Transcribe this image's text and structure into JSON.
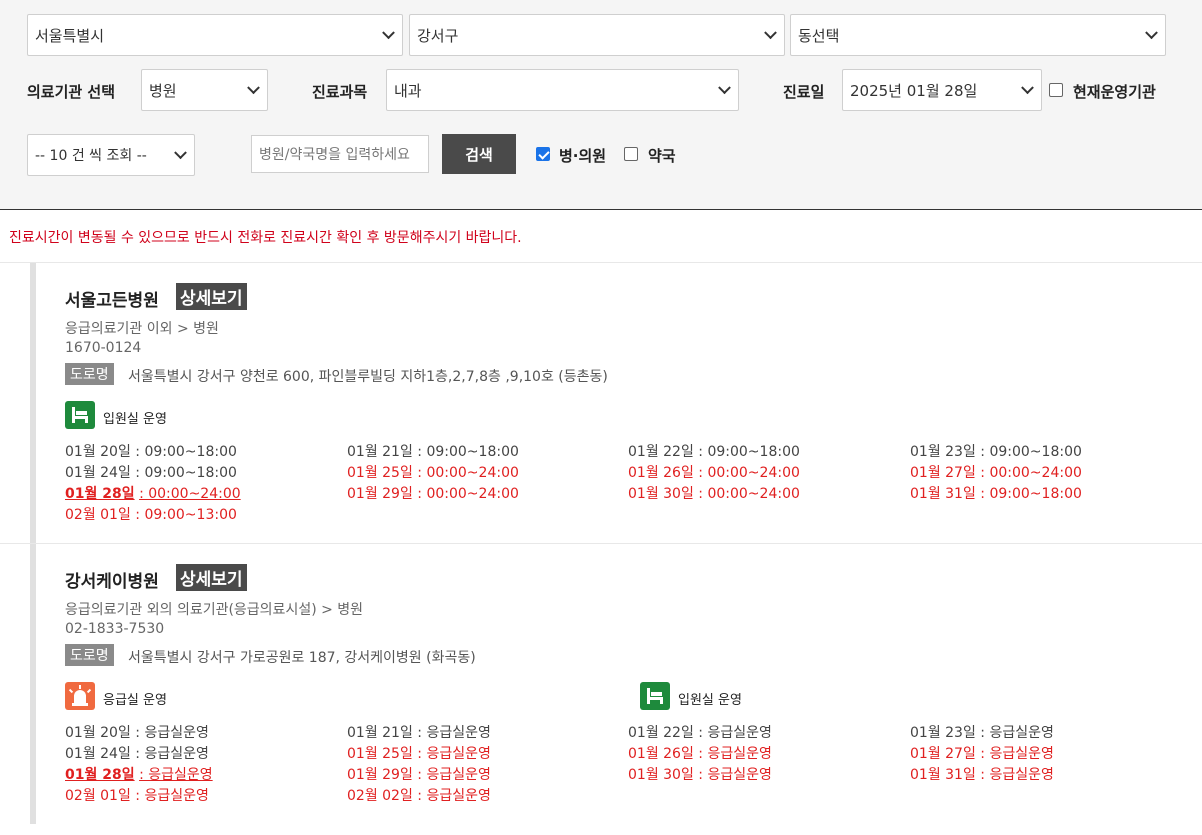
{
  "filters": {
    "region1": "서울특별시",
    "region2": "강서구",
    "region3": "동선택",
    "institution_label": "의료기관 선택",
    "institution_value": "병원",
    "department_label": "진료과목",
    "department_value": "내과",
    "date_label": "진료일",
    "date_value": "2025년 01월 28일",
    "open_now_label": "현재운영기관",
    "page_size": "-- 10 건 씩 조회 --",
    "search_placeholder": "병원/약국명을 입력하세요",
    "search_button": "검색",
    "hospital_label": "병·의원",
    "pharmacy_label": "약국"
  },
  "notice": "진료시간이 변동될 수 있으므로 반드시 전화로 진료시간 확인 후 방문해주시기 바랍니다.",
  "detail_label": "상세보기",
  "road_label": "도로명",
  "hospitals": [
    {
      "name": "서울고든병원",
      "category": "응급의료기관 이외 > 병원",
      "phone": "1670-0124",
      "address": "서울특별시 강서구 양천로 600, 파인블루빌딩 지하1층,2,7,8층 ,9,10호 (등촌동)",
      "services": [
        {
          "icon": "bed-icon",
          "label": "입원실 운영"
        }
      ],
      "schedule": [
        {
          "date": "01월 20일",
          "time": ": 09:00~18:00",
          "style": "normal"
        },
        {
          "date": "01월 21일",
          "time": ": 09:00~18:00",
          "style": "normal"
        },
        {
          "date": "01월 22일",
          "time": ": 09:00~18:00",
          "style": "normal"
        },
        {
          "date": "01월 23일",
          "time": ": 09:00~18:00",
          "style": "normal"
        },
        {
          "date": "01월 24일",
          "time": ": 09:00~18:00",
          "style": "normal"
        },
        {
          "date": "01월 25일",
          "time": ": 00:00~24:00",
          "style": "red"
        },
        {
          "date": "01월 26일",
          "time": ": 00:00~24:00",
          "style": "red"
        },
        {
          "date": "01월 27일",
          "time": ": 00:00~24:00",
          "style": "red"
        },
        {
          "date": "01월 28일",
          "time": ": 00:00~24:00",
          "style": "today"
        },
        {
          "date": "01월 29일",
          "time": ": 00:00~24:00",
          "style": "red"
        },
        {
          "date": "01월 30일",
          "time": ": 00:00~24:00",
          "style": "red"
        },
        {
          "date": "01월 31일",
          "time": ": 09:00~18:00",
          "style": "red"
        },
        {
          "date": "02월 01일",
          "time": ": 09:00~13:00",
          "style": "red"
        }
      ]
    },
    {
      "name": "강서케이병원",
      "category": "응급의료기관 외의 의료기관(응급의료시설) > 병원",
      "phone": "02-1833-7530",
      "address": "서울특별시 강서구 가로공원로 187, 강서케이병원 (화곡동)",
      "services": [
        {
          "icon": "siren-icon",
          "label": "응급실 운영"
        },
        {
          "icon": "bed-icon",
          "label": "입원실 운영"
        }
      ],
      "schedule": [
        {
          "date": "01월 20일",
          "time": ": 응급실운영",
          "style": "normal"
        },
        {
          "date": "01월 21일",
          "time": ": 응급실운영",
          "style": "normal"
        },
        {
          "date": "01월 22일",
          "time": ": 응급실운영",
          "style": "normal"
        },
        {
          "date": "01월 23일",
          "time": ": 응급실운영",
          "style": "normal"
        },
        {
          "date": "01월 24일",
          "time": ": 응급실운영",
          "style": "normal"
        },
        {
          "date": "01월 25일",
          "time": ": 응급실운영",
          "style": "red"
        },
        {
          "date": "01월 26일",
          "time": ": 응급실운영",
          "style": "red"
        },
        {
          "date": "01월 27일",
          "time": ": 응급실운영",
          "style": "red"
        },
        {
          "date": "01월 28일",
          "time": ": 응급실운영",
          "style": "today"
        },
        {
          "date": "01월 29일",
          "time": ": 응급실운영",
          "style": "red"
        },
        {
          "date": "01월 30일",
          "time": ": 응급실운영",
          "style": "red"
        },
        {
          "date": "01월 31일",
          "time": ": 응급실운영",
          "style": "red"
        },
        {
          "date": "02월 01일",
          "time": ": 응급실운영",
          "style": "red"
        },
        {
          "date": "02월 02일",
          "time": ": 응급실운영",
          "style": "red"
        }
      ]
    }
  ]
}
